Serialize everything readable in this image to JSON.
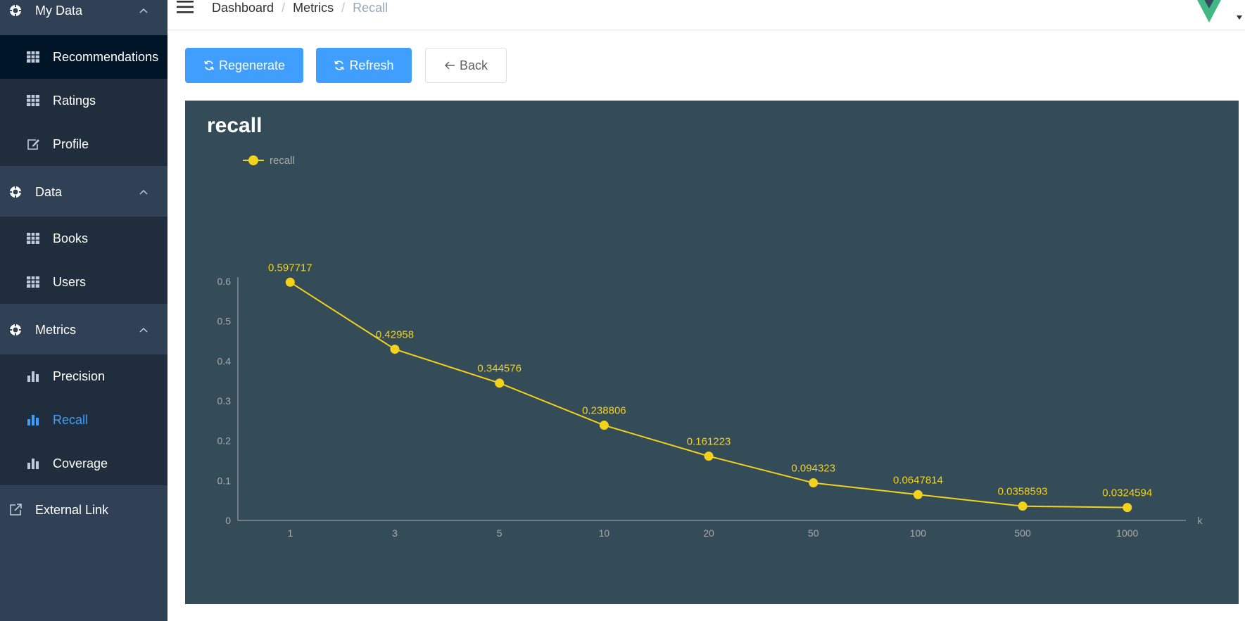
{
  "sidebar": {
    "groups": [
      {
        "label": "My Data",
        "items": [
          {
            "label": "Recommendations",
            "icon": "table-icon"
          },
          {
            "label": "Ratings",
            "icon": "table-icon"
          },
          {
            "label": "Profile",
            "icon": "edit-icon"
          }
        ]
      },
      {
        "label": "Data",
        "items": [
          {
            "label": "Books",
            "icon": "table-icon"
          },
          {
            "label": "Users",
            "icon": "table-icon"
          }
        ]
      },
      {
        "label": "Metrics",
        "items": [
          {
            "label": "Precision",
            "icon": "bar-chart-icon"
          },
          {
            "label": "Recall",
            "icon": "bar-chart-icon"
          },
          {
            "label": "Coverage",
            "icon": "bar-chart-icon"
          }
        ]
      }
    ],
    "external_link": "External Link",
    "active_item": "Recall",
    "active_color": "#409eff",
    "bg_color": "#304156",
    "submenu_bg_color": "#1f2d3d"
  },
  "navbar": {
    "breadcrumb": [
      "Dashboard",
      "Metrics",
      "Recall"
    ],
    "separator": "/"
  },
  "toolbar": {
    "regenerate_label": "Regenerate",
    "refresh_label": "Refresh",
    "back_label": "Back",
    "primary_color": "#409eff"
  },
  "chart_data": {
    "type": "line",
    "title": "recall",
    "categories": [
      "1",
      "3",
      "5",
      "10",
      "20",
      "50",
      "100",
      "500",
      "1000"
    ],
    "series": [
      {
        "name": "recall",
        "values": [
          0.597717,
          0.42958,
          0.344576,
          0.238806,
          0.161223,
          0.094323,
          0.0647814,
          0.0358593,
          0.0324594
        ],
        "color": "#f3d21b"
      }
    ],
    "data_labels": [
      "0.597717",
      "0.42958",
      "0.344576",
      "0.238806",
      "0.161223",
      "0.094323",
      "0.0647814",
      "0.0358593",
      "0.0324594"
    ],
    "xlabel": "k",
    "ylabel": "",
    "ylim": [
      0,
      0.6
    ],
    "yticks": [
      "0",
      "0.1",
      "0.2",
      "0.3",
      "0.4",
      "0.5",
      "0.6"
    ],
    "grid": false,
    "legend_position": "top-left",
    "background_color": "#344b58"
  }
}
